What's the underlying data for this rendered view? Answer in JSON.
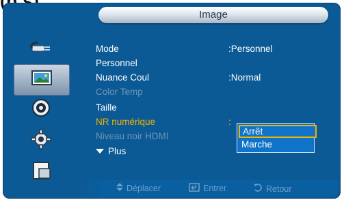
{
  "top_caption": "(p.s)",
  "window": {
    "title": "Image"
  },
  "sidebar": {
    "items": [
      {
        "icon": "input-plug-icon",
        "selected": false
      },
      {
        "icon": "picture-icon",
        "selected": true
      },
      {
        "icon": "sound-speaker-icon",
        "selected": false
      },
      {
        "icon": "setup-gear-icon",
        "selected": false
      },
      {
        "icon": "multi-screen-icon",
        "selected": false
      }
    ]
  },
  "menu": {
    "items": [
      {
        "label": "Mode",
        "value": ":Personnel",
        "state": "normal"
      },
      {
        "label": "Personnel",
        "value": "",
        "state": "normal"
      },
      {
        "label": "Nuance Coul",
        "value": ":Normal",
        "state": "normal"
      },
      {
        "label": "Color Temp",
        "value": "",
        "state": "disabled"
      },
      {
        "label": "Taille",
        "value": "",
        "state": "normal"
      },
      {
        "label": "NR numérique",
        "value": ":",
        "state": "selected"
      },
      {
        "label": "Niveau noir HDMI",
        "value": "",
        "state": "disabled"
      },
      {
        "label": "Plus",
        "value": "",
        "state": "normal"
      }
    ]
  },
  "dropdown": {
    "options": [
      "Arrêt",
      "Marche"
    ],
    "selected": "Arrêt"
  },
  "bottom_bar": {
    "move_label": "Déplacer",
    "enter_label": "Entrer",
    "return_label": "Retour"
  },
  "colors": {
    "background": "#0b5a96",
    "accent": "#f0b300",
    "dropdown": "#0f74c9",
    "disabled": "#6f94b7"
  }
}
